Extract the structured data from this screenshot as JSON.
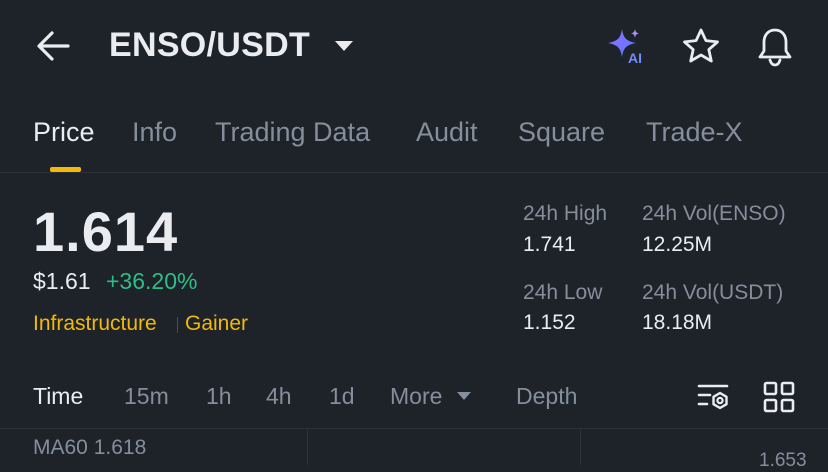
{
  "header": {
    "pair": "ENSO/USDT",
    "icons": [
      "back-arrow-icon",
      "caret-down-icon",
      "ai-sparkle-icon",
      "star-icon",
      "bell-icon"
    ]
  },
  "tabs": [
    {
      "label": "Price",
      "active": true
    },
    {
      "label": "Info"
    },
    {
      "label": "Trading Data"
    },
    {
      "label": "Audit"
    },
    {
      "label": "Square"
    },
    {
      "label": "Trade-X"
    }
  ],
  "price": {
    "last": "1.614",
    "usd": "$1.61",
    "change": "+36.20%",
    "tags": [
      "Infrastructure",
      "Gainer"
    ]
  },
  "stats": {
    "high_label": "24h High",
    "high_value": "1.741",
    "low_label": "24h Low",
    "low_value": "1.152",
    "vol_base_label": "24h Vol(ENSO)",
    "vol_base_value": "12.25M",
    "vol_quote_label": "24h Vol(USDT)",
    "vol_quote_value": "18.18M"
  },
  "intervals": {
    "items": [
      "Time",
      "15m",
      "1h",
      "4h",
      "1d",
      "More"
    ],
    "active": "Time",
    "depth": "Depth"
  },
  "chart": {
    "ma_label": "MA60 1.618",
    "axis_top": "1.653"
  },
  "colors": {
    "background": "#1e2329",
    "accent": "#f0b90b",
    "positive": "#2ebd85",
    "muted": "#848e9c",
    "text": "#eaecef"
  }
}
